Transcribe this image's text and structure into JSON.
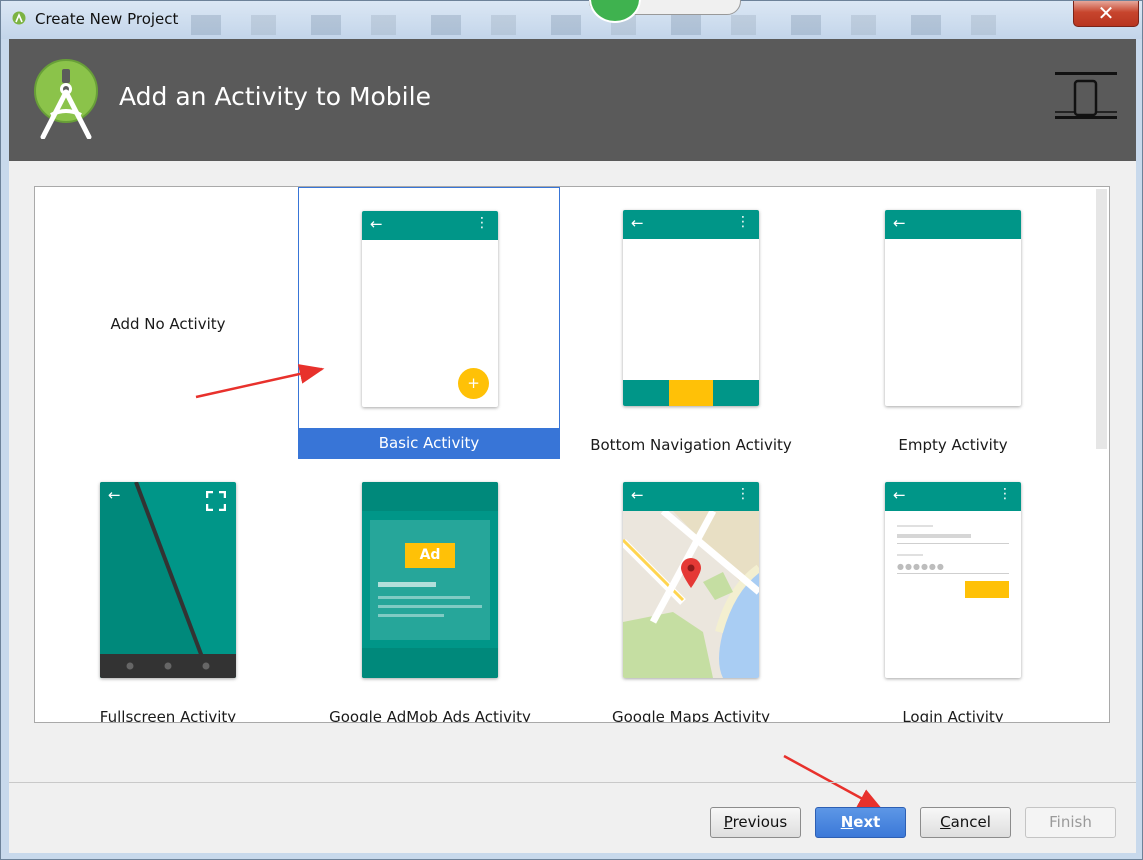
{
  "window": {
    "title": "Create New Project",
    "close_symbol": "✕"
  },
  "header": {
    "title": "Add an Activity to Mobile",
    "logo_icon": "android-studio-logo-icon",
    "form_factor_icon": "phone-form-factor-icon"
  },
  "gallery": {
    "selected": "Basic Activity",
    "tiles": [
      {
        "label": "Add No Activity"
      },
      {
        "label": "Basic Activity"
      },
      {
        "label": "Bottom Navigation Activity"
      },
      {
        "label": "Empty Activity"
      },
      {
        "label": "Fullscreen Activity"
      },
      {
        "label": "Google AdMob Ads Activity"
      },
      {
        "label": "Google Maps Activity"
      },
      {
        "label": "Login Activity"
      }
    ],
    "ad_badge": "Ad",
    "fab_symbol": "+"
  },
  "buttons": {
    "previous_first": "P",
    "previous_rest": "revious",
    "next_first": "N",
    "next_rest": "ext",
    "cancel_first": "C",
    "cancel_rest": "ancel",
    "finish": "Finish"
  },
  "colors": {
    "teal": "#009688",
    "amber": "#FFC107",
    "selection": "#3875D7",
    "banner": "#5A5A5A",
    "annotation_arrow": "#E8312C"
  }
}
